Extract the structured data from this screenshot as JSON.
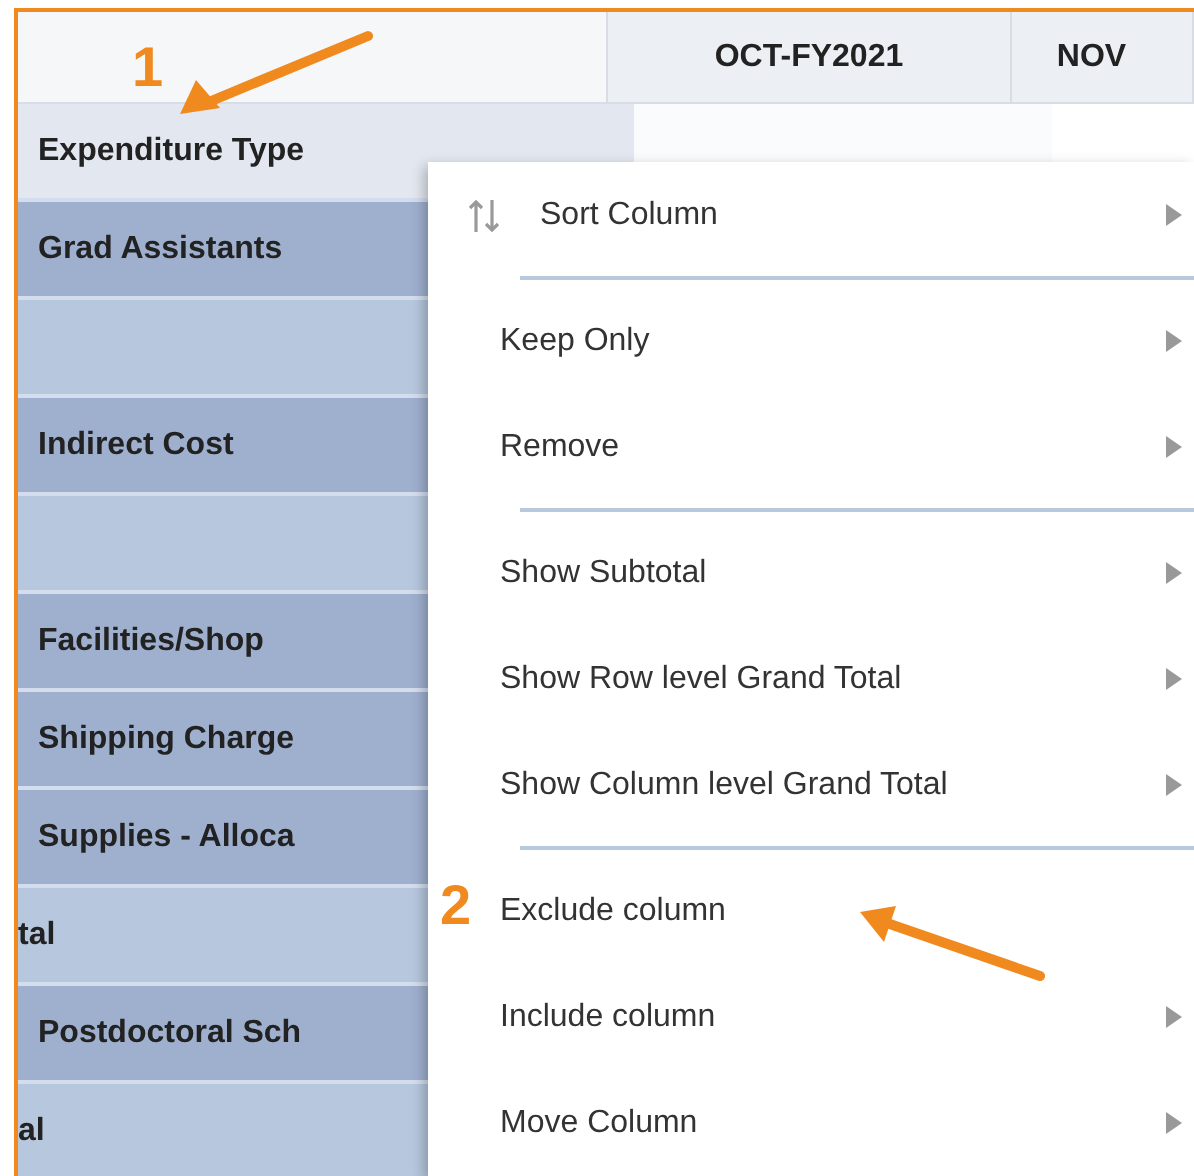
{
  "table": {
    "columns": [
      "OCT-FY2021",
      "NOV"
    ],
    "header_label": "Expenditure Type",
    "rows": [
      {
        "label": "Grad Assistants",
        "kind": "group"
      },
      {
        "kind": "total"
      },
      {
        "label": "Indirect Cost",
        "kind": "group"
      },
      {
        "kind": "total"
      },
      {
        "label": "Facilities/Shop",
        "kind": "group"
      },
      {
        "label": "Shipping Charge",
        "kind": "group"
      },
      {
        "label": "Supplies - Alloca",
        "kind": "group"
      },
      {
        "label": "tal",
        "kind": "total"
      },
      {
        "label": "Postdoctoral Sch",
        "kind": "group"
      },
      {
        "label": "al",
        "kind": "total"
      }
    ]
  },
  "context_menu": {
    "sections": [
      [
        {
          "label": "Sort Column",
          "kind": "sort",
          "submenu": true
        }
      ],
      [
        {
          "label": "Keep Only",
          "kind": "plain",
          "submenu": true
        },
        {
          "label": "Remove",
          "kind": "plain",
          "submenu": true
        }
      ],
      [
        {
          "label": "Show Subtotal",
          "kind": "plain",
          "submenu": true
        },
        {
          "label": "Show Row level Grand Total",
          "kind": "plain",
          "submenu": true
        },
        {
          "label": "Show Column level Grand Total",
          "kind": "plain",
          "submenu": true
        }
      ],
      [
        {
          "label": "Exclude column",
          "kind": "plain",
          "submenu": false
        },
        {
          "label": "Include column",
          "kind": "plain",
          "submenu": true
        },
        {
          "label": "Move Column",
          "kind": "plain",
          "submenu": true
        }
      ]
    ]
  },
  "annotations": [
    {
      "label": "1"
    },
    {
      "label": "2"
    }
  ]
}
